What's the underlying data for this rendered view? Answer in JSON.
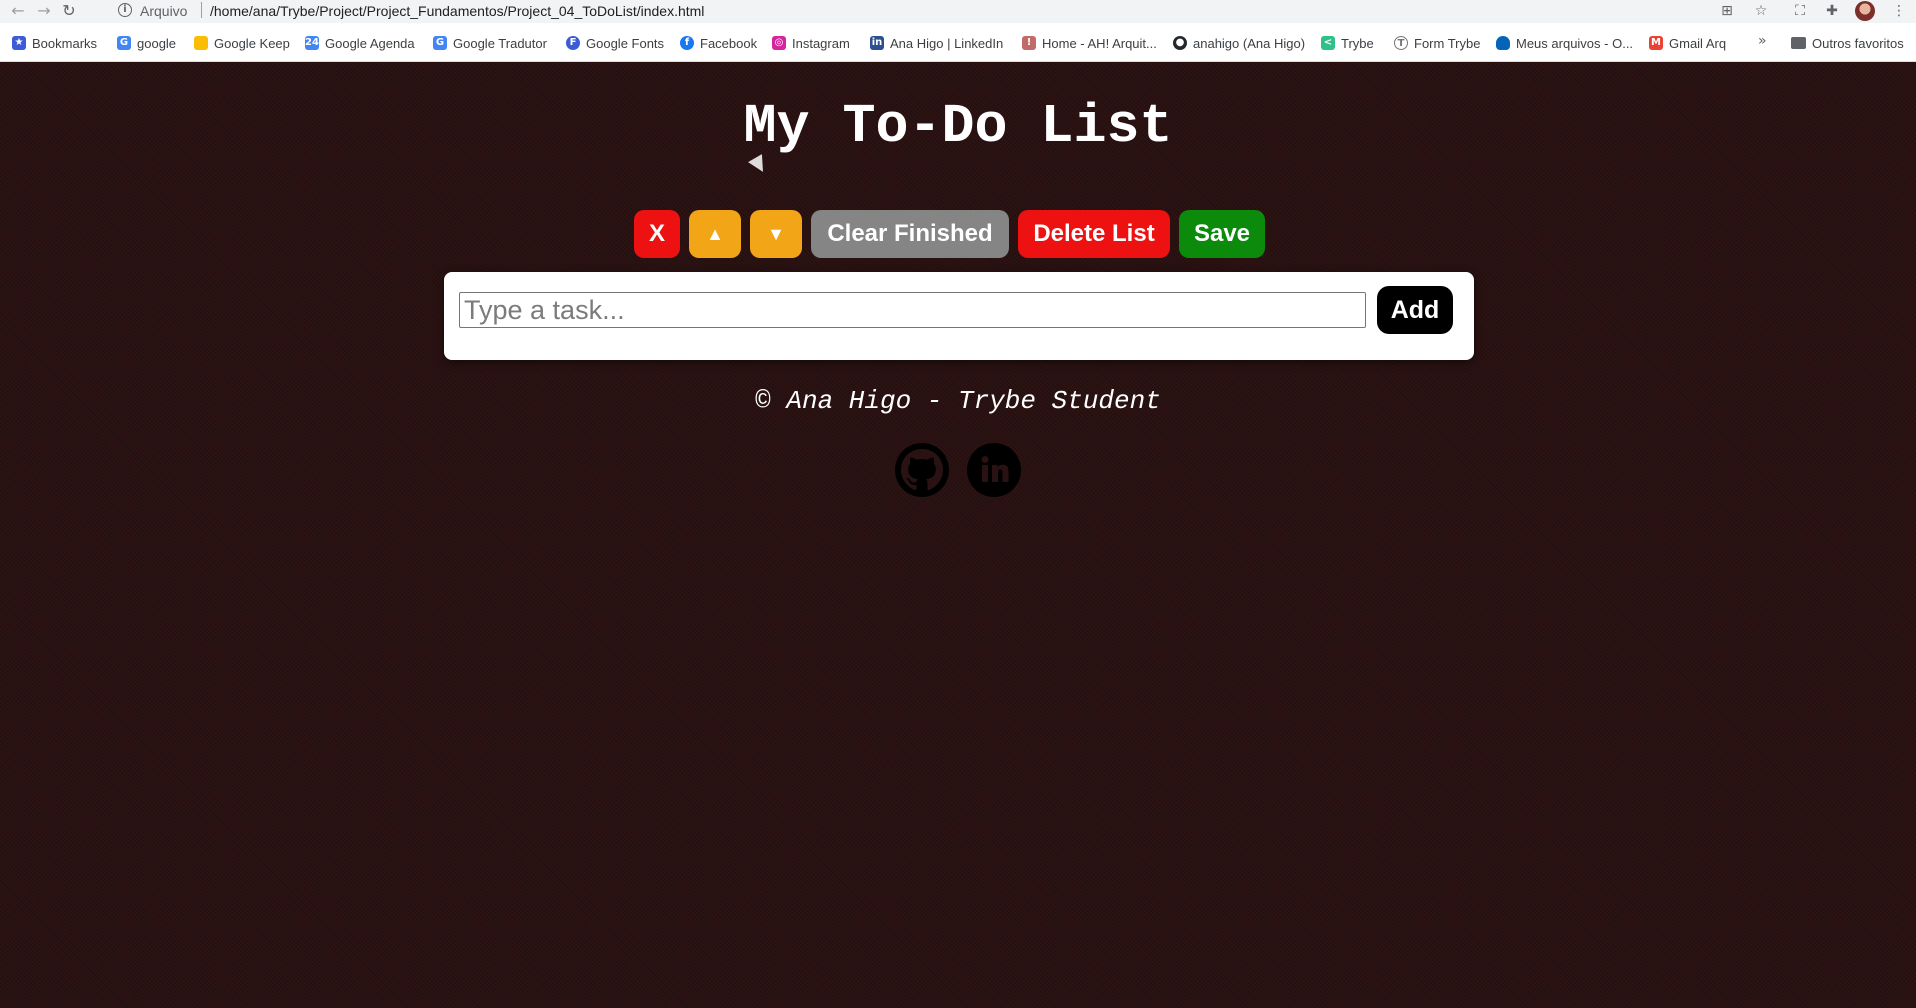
{
  "browser": {
    "scheme_label": "Arquivo",
    "url": "/home/ana/Trybe/Project/Project_Fundamentos/Project_04_ToDoList/index.html",
    "bookmarks": [
      {
        "label": "Bookmarks",
        "icon": "star-icon",
        "color": "#3c5bd6"
      },
      {
        "label": "google",
        "icon": "google-icon",
        "color": "#4285f4"
      },
      {
        "label": "Google Keep",
        "icon": "keep-icon",
        "color": "#fbbc04"
      },
      {
        "label": "Google Agenda",
        "icon": "calendar-icon",
        "color": "#4285f4"
      },
      {
        "label": "Google Tradutor",
        "icon": "translate-icon",
        "color": "#4285f4"
      },
      {
        "label": "Google Fonts",
        "icon": "fonts-icon",
        "color": "#3c5bd6"
      },
      {
        "label": "Facebook",
        "icon": "facebook-icon",
        "color": "#1877f2"
      },
      {
        "label": "Instagram",
        "icon": "instagram-icon",
        "color": "#d6249f"
      },
      {
        "label": "Ana Higo | LinkedIn",
        "icon": "linkedin-icon",
        "color": "#2d4f91"
      },
      {
        "label": "Home - AH! Arquit...",
        "icon": "ah-icon",
        "color": "#c06a6a"
      },
      {
        "label": "anahigo (Ana Higo)",
        "icon": "github-icon",
        "color": "#24292e"
      },
      {
        "label": "Trybe",
        "icon": "trybe-icon",
        "color": "#2fc18c"
      },
      {
        "label": "Form Trybe",
        "icon": "form-icon",
        "color": "#777777"
      },
      {
        "label": "Meus arquivos - O...",
        "icon": "onedrive-icon",
        "color": "#0364b8"
      },
      {
        "label": "Gmail Arq",
        "icon": "gmail-icon",
        "color": "#ea4335"
      }
    ],
    "more_label": "»",
    "other_favorites": "Outros favoritos"
  },
  "page": {
    "title": "My To-Do List",
    "buttons": {
      "remove_selected": "X",
      "move_up": "▲",
      "move_down": "▼",
      "clear_finished": "Clear Finished",
      "delete_list": "Delete List",
      "save": "Save"
    },
    "input": {
      "placeholder": "Type a task...",
      "value": ""
    },
    "add_label": "Add",
    "footer": "© Ana Higo - Trybe Student",
    "colors": {
      "background": "#2b1212",
      "red": "#ee1111",
      "amber": "#f2a516",
      "gray": "#858585",
      "green": "#0b8a0b"
    }
  }
}
